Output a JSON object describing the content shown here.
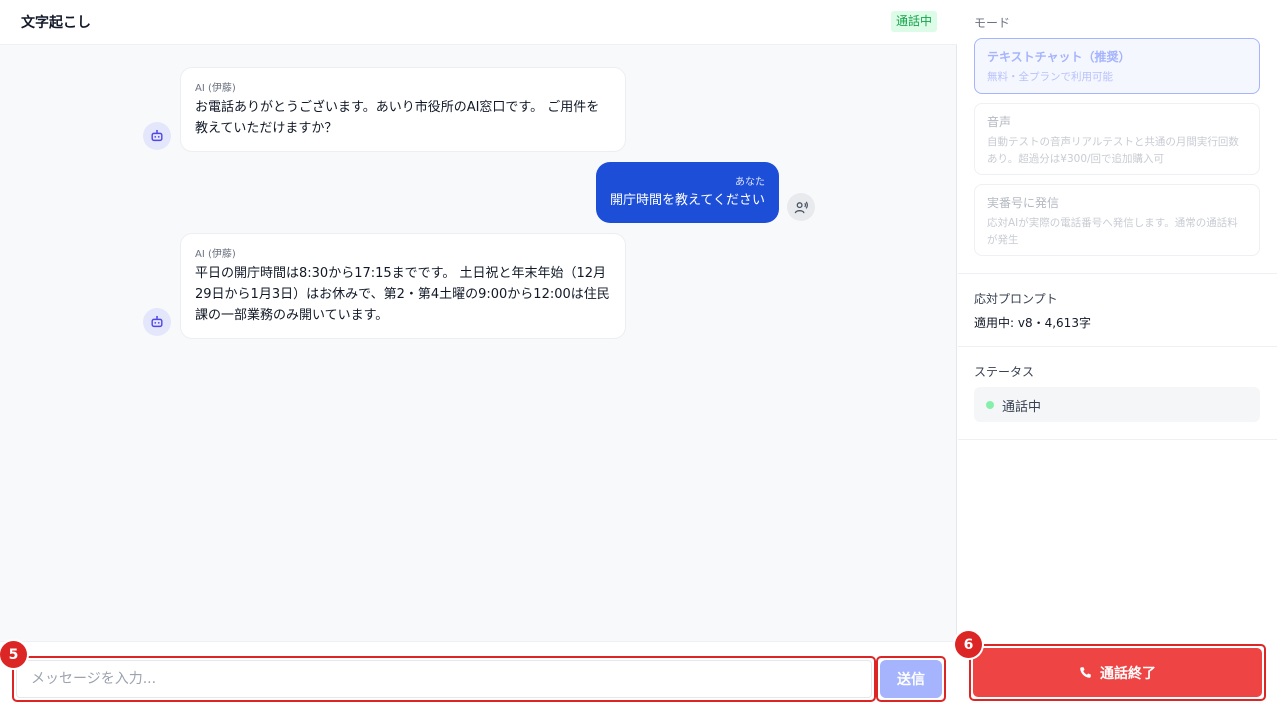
{
  "header": {
    "title": "文字起こし",
    "live_badge": "通話中"
  },
  "messages": [
    {
      "sender": "AI (伊藤)",
      "text": "お電話ありがとうございます。あいり市役所のAI窓口です。 ご用件を教えていただけますか？"
    },
    {
      "sender": "あなた",
      "text": "開庁時間を教えてください"
    },
    {
      "sender": "AI (伊藤)",
      "text": "平日の開庁時間は8:30から17:15までです。 土日祝と年末年始（12月29日から1月3日）はお休みで、第2・第4土曜の9:00から12:00は住民課の一部業務のみ開いています。"
    }
  ],
  "composer": {
    "placeholder": "メッセージを入力...",
    "send_label": "送信",
    "callout_number": "5"
  },
  "sidebar": {
    "mode_label": "モード",
    "modes": [
      {
        "title": "テキストチャット（推奨）",
        "desc": "無料・全プランで利用可能",
        "selected": true
      },
      {
        "title": "音声",
        "desc": "自動テストの音声リアルテストと共通の月間実行回数あり。超過分は¥300/回で追加購入可",
        "selected": false
      },
      {
        "title": "実番号に発信",
        "desc": "応対AIが実際の電話番号へ発信します。通常の通話料が発生",
        "selected": false
      }
    ],
    "prompt_label": "応対プロンプト",
    "prompt_value": "適用中: v8・4,613字",
    "status_label": "ステータス",
    "status_value": "通話中",
    "end_call_label": "通話終了",
    "end_callout_number": "6"
  },
  "colors": {
    "accent": "#1d4ed8",
    "danger": "#ef4444",
    "success": "#16a34a"
  }
}
